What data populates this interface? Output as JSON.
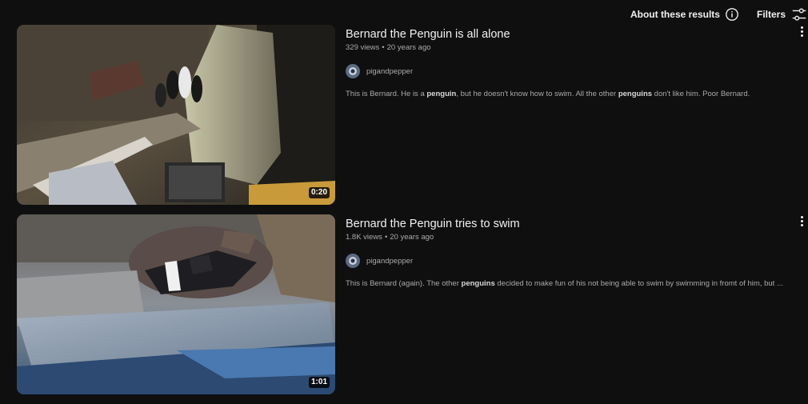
{
  "header": {
    "about_label": "About these results",
    "filters_label": "Filters",
    "about_icon": "info-icon",
    "filters_icon": "sliders-icon"
  },
  "results": [
    {
      "title": "Bernard the Penguin is all alone",
      "views": "329 views",
      "age": "20 years ago",
      "channel": "pigandpepper",
      "duration": "0:20",
      "description": [
        {
          "text": "This is Bernard. He is a ",
          "bold": false
        },
        {
          "text": "penguin",
          "bold": true
        },
        {
          "text": ", but he doesn't know how to swim. All the other ",
          "bold": false
        },
        {
          "text": "penguins",
          "bold": true
        },
        {
          "text": " don't like him. Poor Bernard.",
          "bold": false
        }
      ]
    },
    {
      "title": "Bernard the Penguin tries to swim",
      "views": "1.8K views",
      "age": "20 years ago",
      "channel": "pigandpepper",
      "duration": "1:01",
      "description": [
        {
          "text": "This is Bernard (again). The other ",
          "bold": false
        },
        {
          "text": "penguins",
          "bold": true
        },
        {
          "text": " decided to make fun of his not being able to swim by swimming in fromt of him, but ...",
          "bold": false
        }
      ]
    }
  ],
  "colors": {
    "background": "#0f0f0f",
    "text_primary": "#f1f1f1",
    "text_secondary": "#aaaaaa"
  }
}
